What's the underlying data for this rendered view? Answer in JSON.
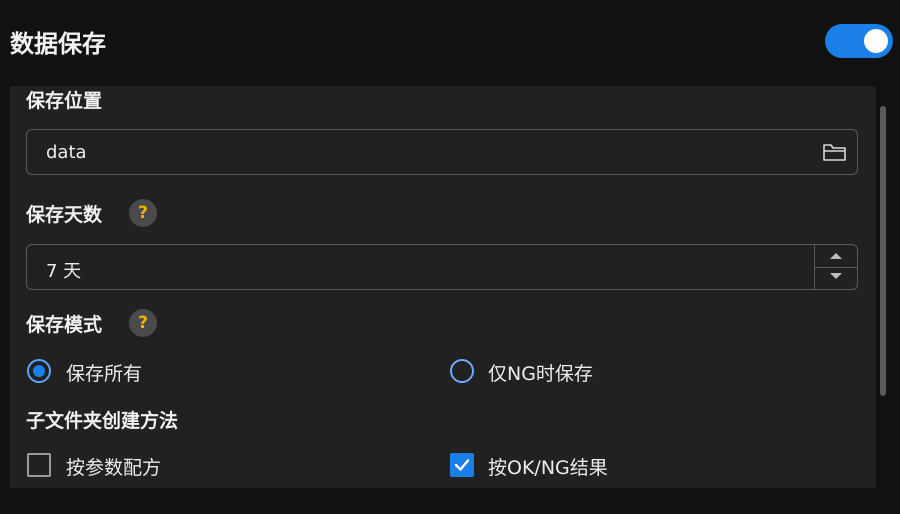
{
  "header": {
    "title": "数据保存",
    "toggle_on": true
  },
  "storage_location": {
    "label": "保存位置",
    "value": "data",
    "browse_icon": "folder-icon"
  },
  "retention_days": {
    "label": "保存天数",
    "help": "?",
    "value": "7 天"
  },
  "save_mode": {
    "label": "保存模式",
    "help": "?",
    "options": [
      {
        "label": "保存所有",
        "selected": true
      },
      {
        "label": "仅NG时保存",
        "selected": false
      }
    ]
  },
  "subfolder_method": {
    "label": "子文件夹创建方法",
    "options": [
      {
        "label": "按参数配方",
        "checked": false
      },
      {
        "label": "按OK/NG结果",
        "checked": true
      }
    ]
  },
  "colors": {
    "accent": "#1a7fe6",
    "help_mark": "#f0b400",
    "panel_bg": "#212121",
    "page_bg": "#111111"
  }
}
